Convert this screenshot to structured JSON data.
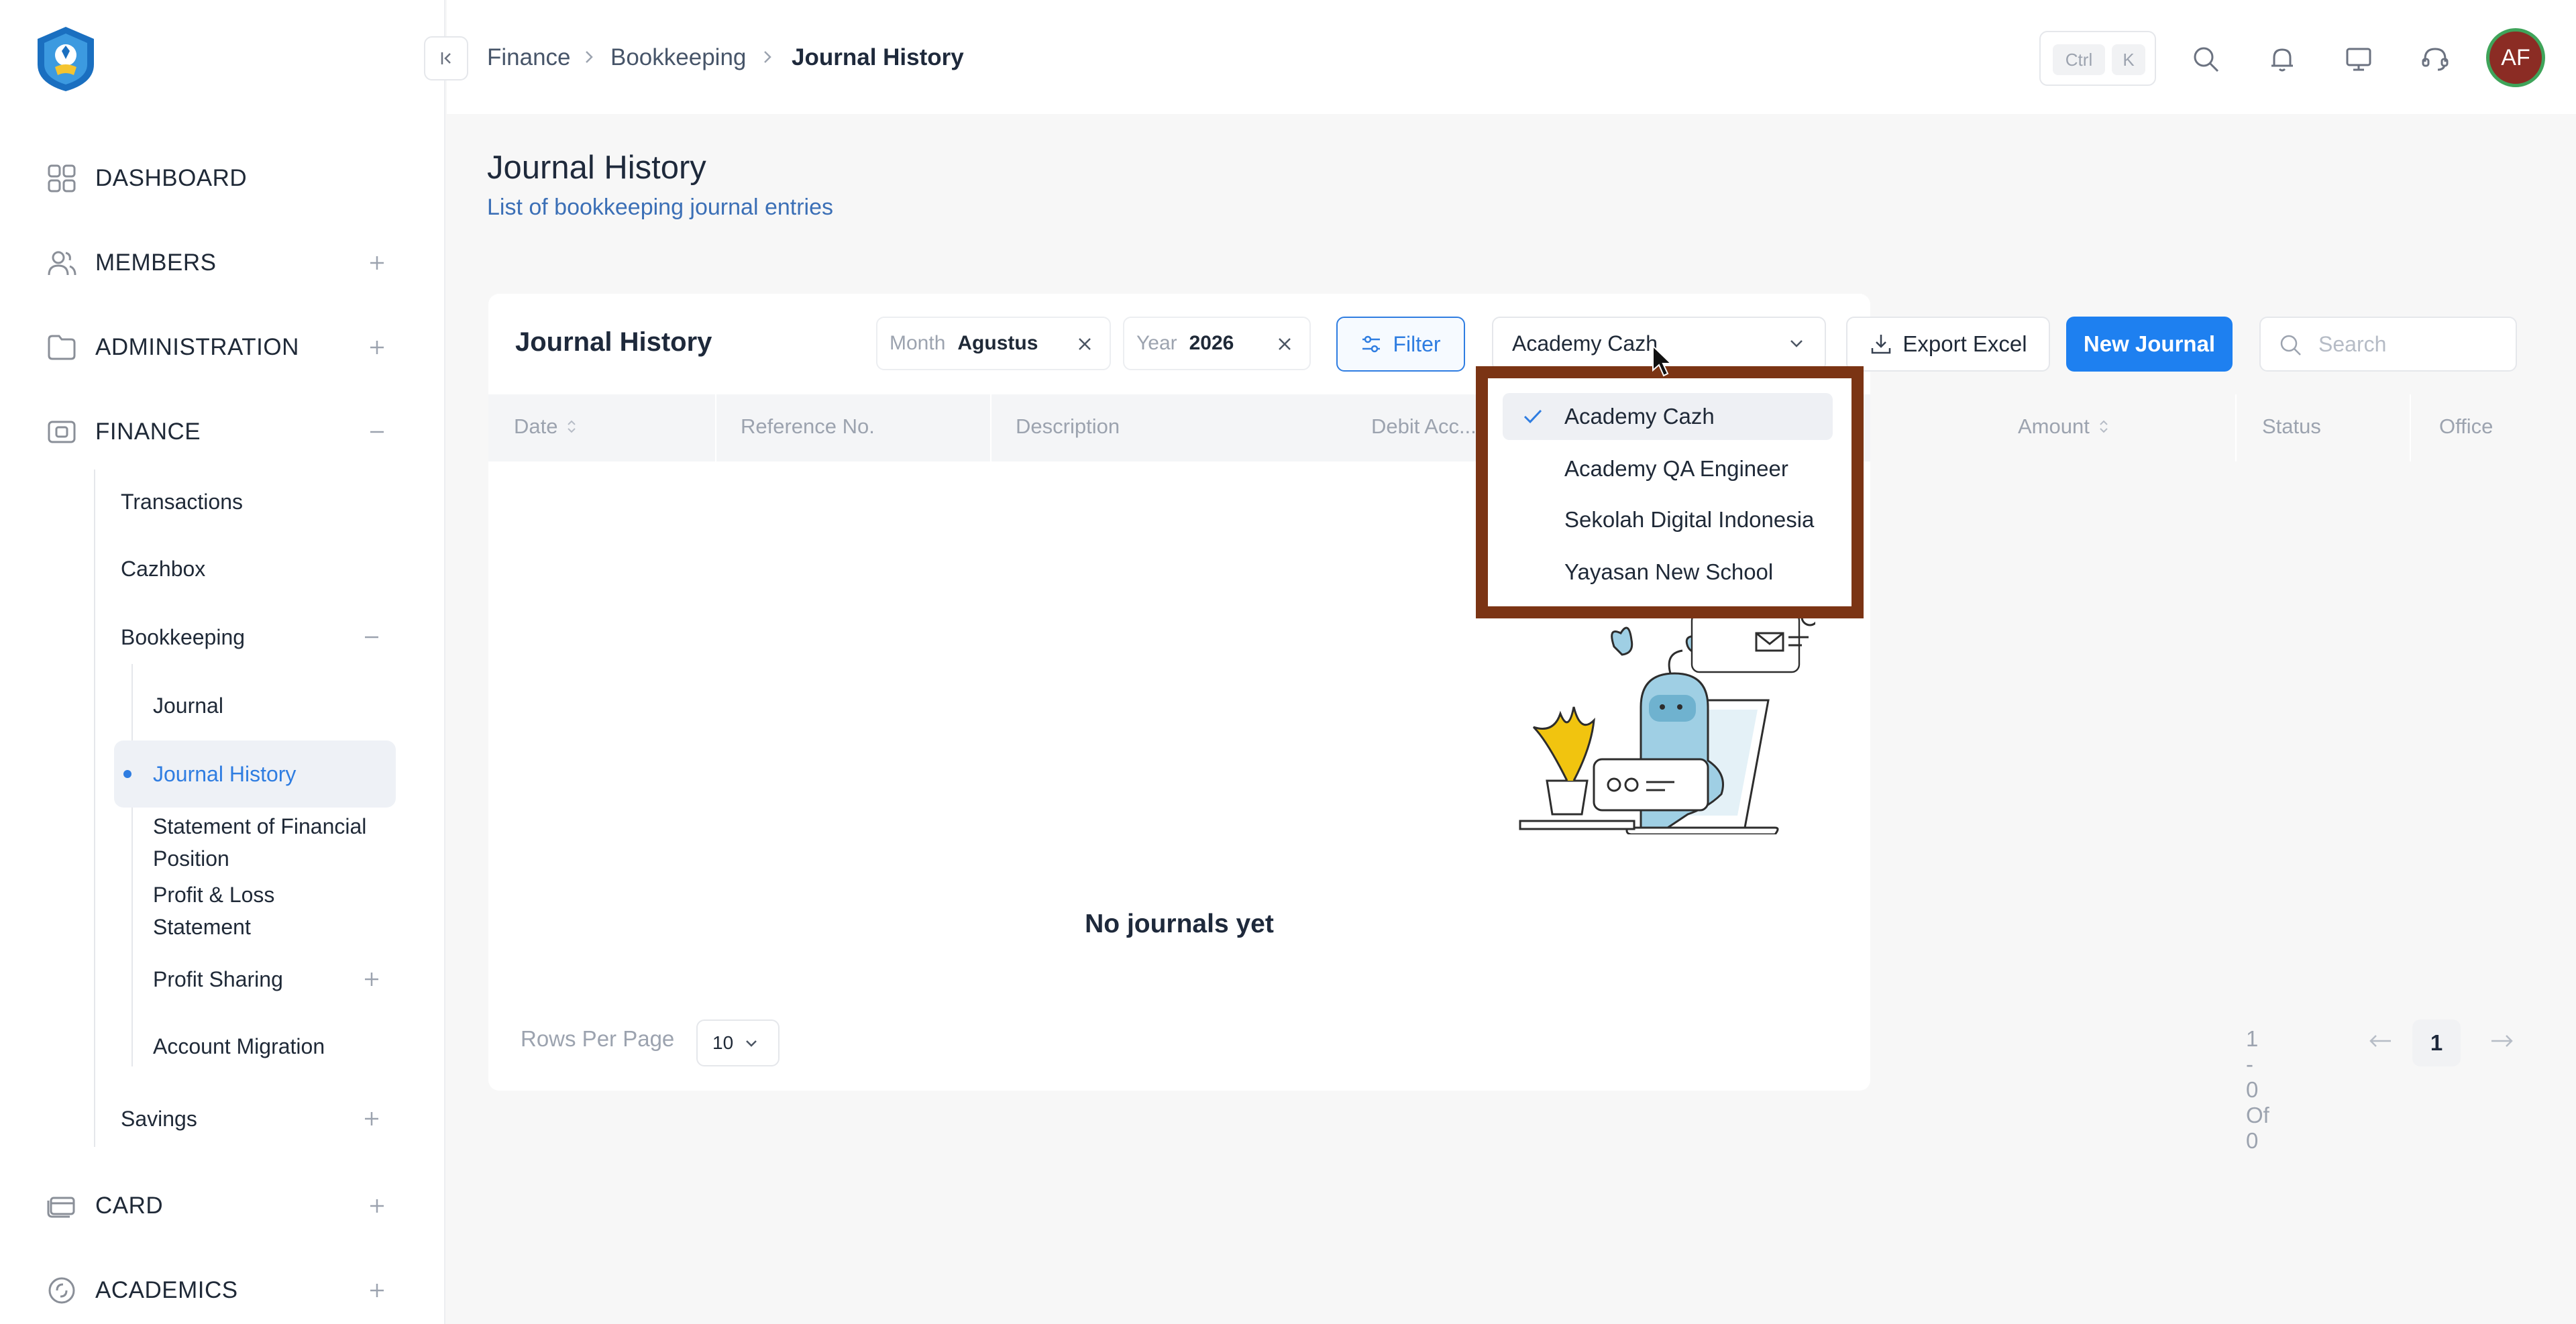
{
  "sidebar": {
    "nav": [
      {
        "label": "DASHBOARD",
        "icon": "dashboard-grid-icon",
        "toggle": ""
      },
      {
        "label": "MEMBERS",
        "icon": "members-icon",
        "toggle": "+"
      },
      {
        "label": "ADMINISTRATION",
        "icon": "folder-icon",
        "toggle": "+"
      },
      {
        "label": "FINANCE",
        "icon": "wallet-icon",
        "toggle": "−"
      },
      {
        "label": "CARD",
        "icon": "card-icon",
        "toggle": "+"
      },
      {
        "label": "ACADEMICS",
        "icon": "academics-icon",
        "toggle": "+"
      }
    ],
    "finance_items": [
      {
        "label": "Transactions"
      },
      {
        "label": "Cazhbox"
      },
      {
        "label": "Bookkeeping"
      },
      {
        "label": "Savings"
      }
    ],
    "bookkeeping_items": [
      {
        "label": "Journal"
      },
      {
        "label": "Journal History"
      },
      {
        "label": "Statement of Financial Position"
      },
      {
        "label": "Profit & Loss Statement"
      },
      {
        "label": "Profit Sharing"
      },
      {
        "label": "Account Migration"
      }
    ]
  },
  "header": {
    "breadcrumb": [
      "Finance",
      "Bookkeeping",
      "Journal History"
    ],
    "shortcut": {
      "key1": "Ctrl",
      "key2": "K"
    },
    "avatar_initials": "AF"
  },
  "page": {
    "title": "Journal History",
    "subtitle": "List of bookkeeping journal entries"
  },
  "card": {
    "title": "Journal History",
    "month_filter": {
      "label": "Month",
      "value": "Agustus"
    },
    "year_filter": {
      "label": "Year",
      "value": "2026"
    },
    "filter_label": "Filter",
    "office_select": {
      "value": "Academy Cazh"
    },
    "export_label": "Export Excel",
    "new_journal_label": "New Journal",
    "search_placeholder": "Search",
    "columns": [
      "Date",
      "Reference No.",
      "Description",
      "Debit Acc...",
      "",
      "Amount",
      "Status",
      "Office"
    ],
    "empty_text": "No journals yet",
    "rows_per_page_label": "Rows Per Page",
    "rows_per_page_value": "10",
    "pagination_info": "1 - 0 Of 0",
    "current_page": "1"
  },
  "dropdown": {
    "options": [
      {
        "label": "Academy Cazh",
        "selected": true
      },
      {
        "label": "Academy QA Engineer",
        "selected": false
      },
      {
        "label": "Sekolah Digital Indonesia",
        "selected": false
      },
      {
        "label": "Yayasan New School",
        "selected": false
      }
    ],
    "highlight_color": "#7b3414"
  },
  "colors": {
    "accent": "#1e80f0",
    "link": "#2f7de1",
    "avatar_bg": "#8b2c24",
    "avatar_ring": "#3fa45a"
  }
}
